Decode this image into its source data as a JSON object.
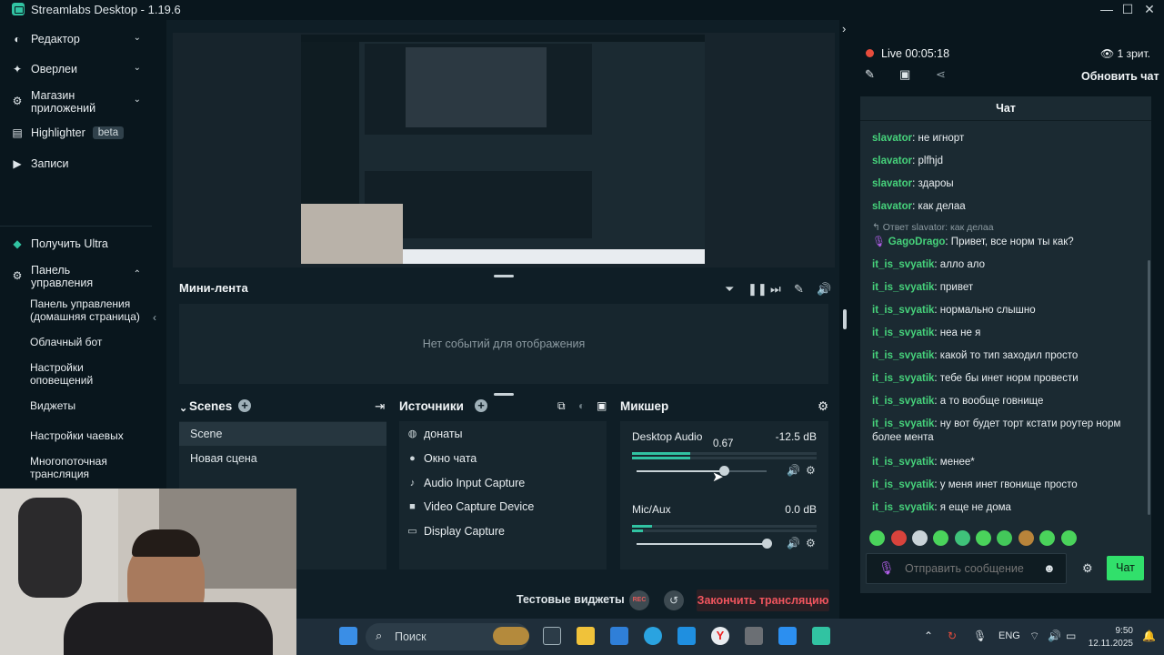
{
  "app": {
    "title": "Streamlabs Desktop - 1.19.6"
  },
  "sidebar": {
    "items": [
      {
        "label": "Редактор"
      },
      {
        "label": "Оверлеи"
      },
      {
        "label": "Магазин приложений"
      },
      {
        "label": "Highlighter",
        "badge": "beta"
      },
      {
        "label": "Записи"
      }
    ],
    "ultra": "Получить Ultra",
    "dashboard": "Панель управления",
    "sub_items": [
      "Панель управления (домашняя страница)",
      "Облачный бот",
      "Настройки оповещений",
      "Виджеты",
      "Настройки чаевых",
      "Многопоточная трансляция"
    ]
  },
  "minifeed": {
    "title": "Мини-лента",
    "empty": "Нет событий для отображения"
  },
  "scenes": {
    "title": "Scenes",
    "items": [
      "Scene",
      "Новая сцена"
    ],
    "selected": "Scene"
  },
  "sources": {
    "title": "Источники",
    "items": [
      {
        "label": "донаты",
        "icon": "globe-icon"
      },
      {
        "label": "Окно чата",
        "icon": "chat-icon"
      },
      {
        "label": "Audio Input Capture",
        "icon": "mic-icon"
      },
      {
        "label": "Video Capture Device",
        "icon": "camera-icon"
      },
      {
        "label": "Display Capture",
        "icon": "monitor-icon"
      }
    ]
  },
  "mixer": {
    "title": "Микшер",
    "channels": [
      {
        "name": "Desktop Audio",
        "db": "-12.5 dB",
        "tooltip": "0.67",
        "volume": 0.67
      },
      {
        "name": "Mic/Aux",
        "db": "0.0 dB",
        "volume": 1.0
      }
    ]
  },
  "bottom": {
    "test_widgets": "Тестовые виджеты",
    "rec": "REC",
    "end_stream": "Закончить трансляцию"
  },
  "chat_panel": {
    "live": "Live 00:05:18",
    "viewers": "1 зрит.",
    "refresh": "Обновить чат",
    "title": "Чат",
    "reply_note": "Ответ slavator: как делаа",
    "messages": [
      {
        "user": "slavator",
        "text": ": не игнорт"
      },
      {
        "user": "slavator",
        "text": ": plfhjd"
      },
      {
        "user": "slavator",
        "text": ": здарoы"
      },
      {
        "user": "slavator",
        "text": ": как делаа"
      },
      {
        "user": "GagoDrago",
        "text": ": Привет, все норм ты как?"
      },
      {
        "user": "it_is_svyatik",
        "text": ": алло ало"
      },
      {
        "user": "it_is_svyatik",
        "text": ": привет"
      },
      {
        "user": "it_is_svyatik",
        "text": ": нормально слышно"
      },
      {
        "user": "it_is_svyatik",
        "text": ": неа не я"
      },
      {
        "user": "it_is_svyatik",
        "text": ": какой то тип заходил просто"
      },
      {
        "user": "it_is_svyatik",
        "text": ": тебе бы инет норм провести"
      },
      {
        "user": "it_is_svyatik",
        "text": ": а то вообще говнище"
      },
      {
        "user": "it_is_svyatik",
        "text": ": ну вот будет торт кстати роутер норм более мента"
      },
      {
        "user": "it_is_svyatik",
        "text": ": менее*"
      },
      {
        "user": "it_is_svyatik",
        "text": ": у меня инет гвонище просто"
      },
      {
        "user": "it_is_svyatik",
        "text": ": я еще не дома"
      }
    ],
    "input_placeholder": "Отправить сообщение",
    "send": "Чат"
  },
  "taskbar": {
    "search": "Поиск",
    "lang": "ENG",
    "time": "9:50",
    "date": "12.11.2025"
  },
  "colors": {
    "accent": "#31c3a2",
    "live": "#e74c3c",
    "chat_green": "#31e06b",
    "end_stream": "#f0555e"
  }
}
